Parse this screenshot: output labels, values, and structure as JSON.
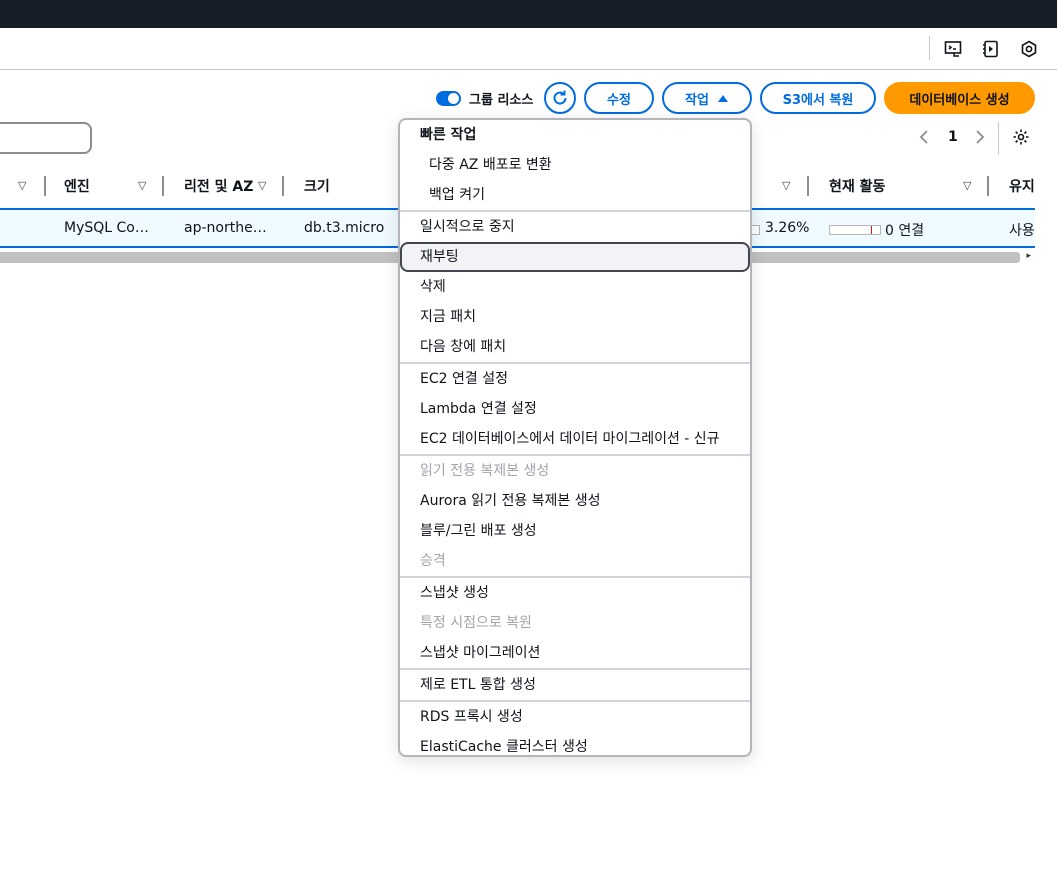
{
  "header_icons": [
    "cloudshell-icon",
    "notifications-panel-icon",
    "settings-hex-icon"
  ],
  "toolbar": {
    "group_resources_label": "그룹 리소스",
    "refresh_icon": "refresh-icon",
    "modify_label": "수정",
    "actions_label": "작업",
    "restore_s3_label": "S3에서 복원",
    "create_db_label": "데이터베이스 생성"
  },
  "pagination": {
    "current_page": "1"
  },
  "table": {
    "columns": [
      "엔진",
      "리전 및 AZ",
      "크기",
      "현재 활동",
      "유지"
    ],
    "row": {
      "engine": "MySQL Co…",
      "region": "ap-northe…",
      "size": "db.t3.micro",
      "cpu": "3.26%",
      "activity": "0 연결",
      "maintenance": "사용"
    }
  },
  "actions_menu": {
    "groups": [
      {
        "items": [
          {
            "label": "빠른 작업",
            "style": "header"
          },
          {
            "label": "다중 AZ 배포로 변환",
            "style": "sub"
          },
          {
            "label": "백업 켜기",
            "style": "sub"
          }
        ]
      },
      {
        "items": [
          {
            "label": "일시적으로 중지"
          },
          {
            "label": "재부팅",
            "style": "hover"
          },
          {
            "label": "삭제"
          },
          {
            "label": "지금 패치"
          },
          {
            "label": "다음 창에 패치"
          }
        ]
      },
      {
        "items": [
          {
            "label": "EC2 연결 설정"
          },
          {
            "label": "Lambda 연결 설정"
          },
          {
            "label": "EC2 데이터베이스에서 데이터 마이그레이션 - 신규"
          }
        ]
      },
      {
        "items": [
          {
            "label": "읽기 전용 복제본 생성",
            "style": "disabled"
          },
          {
            "label": "Aurora 읽기 전용 복제본 생성"
          },
          {
            "label": "블루/그린 배포 생성"
          },
          {
            "label": "승격",
            "style": "disabled"
          }
        ]
      },
      {
        "items": [
          {
            "label": "스냅샷 생성"
          },
          {
            "label": "특정 시점으로 복원",
            "style": "disabled"
          },
          {
            "label": "스냅샷 마이그레이션"
          }
        ]
      },
      {
        "items": [
          {
            "label": "제로 ETL 통합 생성"
          }
        ]
      },
      {
        "items": [
          {
            "label": "RDS 프록시 생성"
          },
          {
            "label": "ElastiCache 클러스터 생성"
          }
        ]
      }
    ]
  },
  "colors": {
    "accent": "#006ce0",
    "primary": "#ff9900",
    "topbar": "#161d26"
  }
}
